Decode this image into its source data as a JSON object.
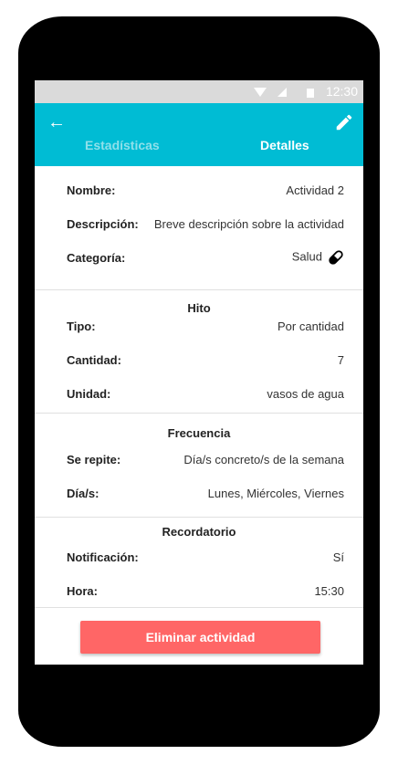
{
  "status": {
    "time": "12:30"
  },
  "header": {
    "tabs": [
      "Estadísticas",
      "Detalles"
    ],
    "active_tab": "Detalles"
  },
  "general": [
    {
      "label": "Nombre:",
      "value": "Actividad 2"
    },
    {
      "label": "Descripción:",
      "value": "Breve descripción sobre la actividad"
    },
    {
      "label": "Categoría:",
      "value": "Salud",
      "icon": "pill-icon"
    }
  ],
  "hito": {
    "title": "Hito",
    "rows": [
      {
        "label": "Tipo:",
        "value": "Por cantidad"
      },
      {
        "label": "Cantidad:",
        "value": "7"
      },
      {
        "label": "Unidad:",
        "value": "vasos de agua"
      }
    ]
  },
  "frecuencia": {
    "title": "Frecuencia",
    "rows": [
      {
        "label": "Se repite:",
        "value": "Día/s concreto/s de la semana"
      },
      {
        "label": "Día/s:",
        "value": "Lunes, Miércoles, Viernes"
      }
    ]
  },
  "recordatorio": {
    "title": "Recordatorio",
    "rows": [
      {
        "label": "Notificación:",
        "value": "Sí"
      },
      {
        "label": "Hora:",
        "value": "15:30"
      }
    ]
  },
  "delete_label": "Eliminar actividad",
  "colors": {
    "primary": "#00bcd4",
    "danger": "#ff6666"
  }
}
